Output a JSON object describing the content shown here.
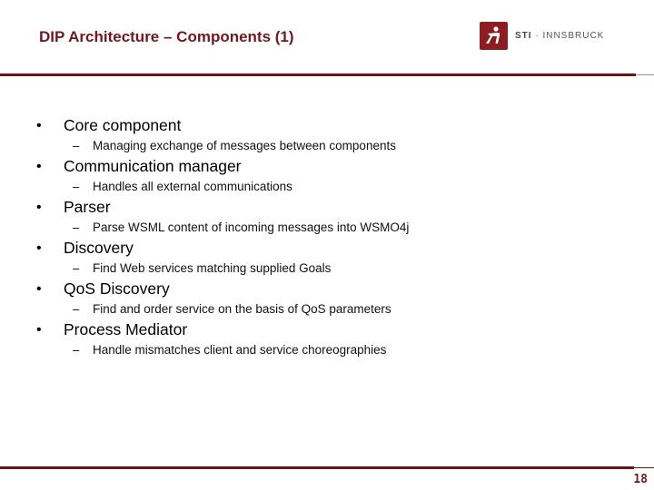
{
  "slide": {
    "title": "DIP Architecture – Components (1)",
    "logo": {
      "icon": "sti-person-icon",
      "brand_bold": "STI",
      "separator": " · ",
      "brand_rest": "INNSBRUCK",
      "color": "#8c1d22"
    },
    "accent_color": "#6b1214",
    "bullets": [
      {
        "label": "Core component",
        "sub": "Managing exchange of messages between components"
      },
      {
        "label": "Communication manager",
        "sub": "Handles all external communications"
      },
      {
        "label": "Parser",
        "sub": "Parse WSML content of incoming messages into WSMO4j"
      },
      {
        "label": "Discovery",
        "sub": "Find Web services matching supplied Goals"
      },
      {
        "label": "QoS Discovery",
        "sub": "Find and order service on the basis of QoS parameters"
      },
      {
        "label": "Process Mediator",
        "sub": "Handle mismatches client and service choreographies"
      }
    ],
    "bullet_glyph": "•",
    "dash_glyph": "–",
    "page_number": "18"
  }
}
